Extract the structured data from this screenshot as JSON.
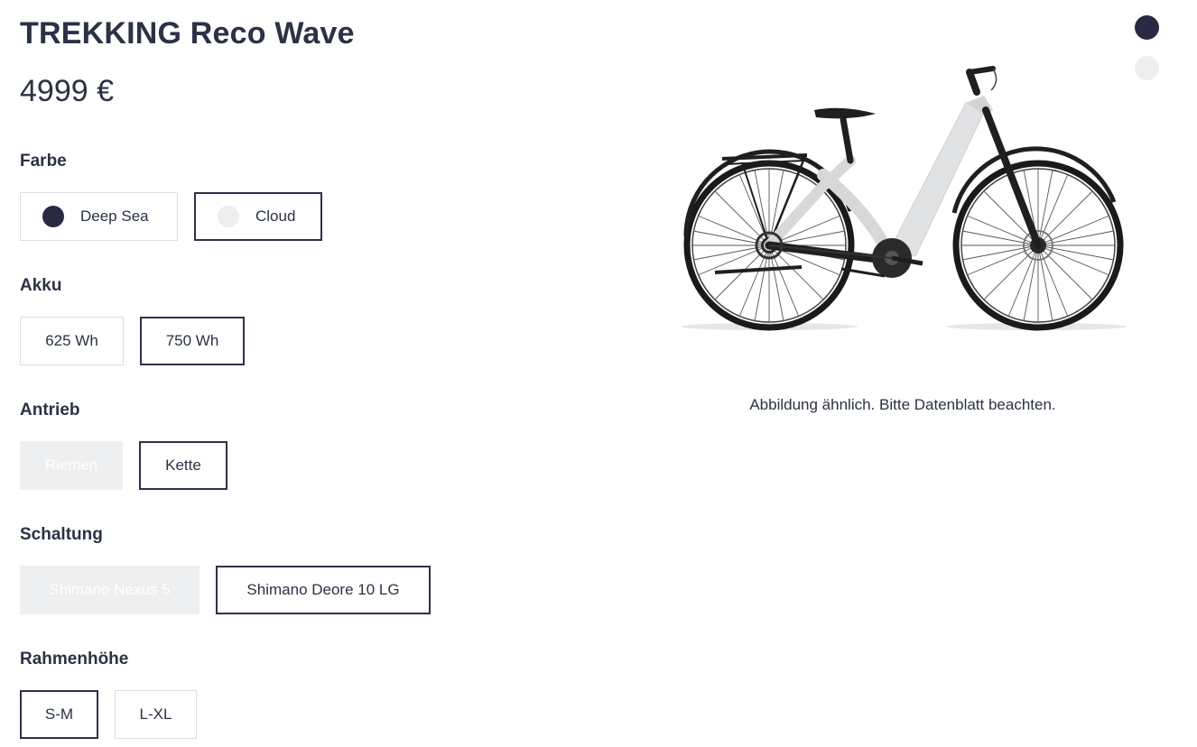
{
  "product": {
    "title": "TREKKING Reco Wave",
    "price": "4999 €"
  },
  "colors": {
    "label": "Farbe",
    "options": [
      {
        "label": "Deep Sea",
        "swatch": "#2a2944",
        "selected": false
      },
      {
        "label": "Cloud",
        "swatch": "#eeeeee",
        "selected": true
      }
    ]
  },
  "battery": {
    "label": "Akku",
    "options": [
      {
        "label": "625 Wh",
        "selected": false
      },
      {
        "label": "750 Wh",
        "selected": true
      }
    ]
  },
  "drive": {
    "label": "Antrieb",
    "options": [
      {
        "label": "Riemen",
        "disabled": true
      },
      {
        "label": "Kette",
        "selected": true
      }
    ]
  },
  "gears": {
    "label": "Schaltung",
    "options": [
      {
        "label": "Shimano Nexus 5",
        "disabled": true
      },
      {
        "label": "Shimano Deore 10 LG",
        "selected": true
      }
    ]
  },
  "frame": {
    "label": "Rahmenhöhe",
    "options": [
      {
        "label": "S-M",
        "selected": true
      },
      {
        "label": "L-XL",
        "selected": false
      }
    ]
  },
  "gallery": {
    "caption": "Abbildung ähnlich. Bitte Datenblatt beachten.",
    "image": "e-bike-icon",
    "dots": [
      {
        "color": "#2a2944",
        "active": true
      },
      {
        "color": "#eeeeee",
        "active": false
      }
    ]
  },
  "colors_theme": {
    "text": "#2b3245",
    "border": "#dcdde2",
    "disabled_bg": "#eeeff1"
  }
}
